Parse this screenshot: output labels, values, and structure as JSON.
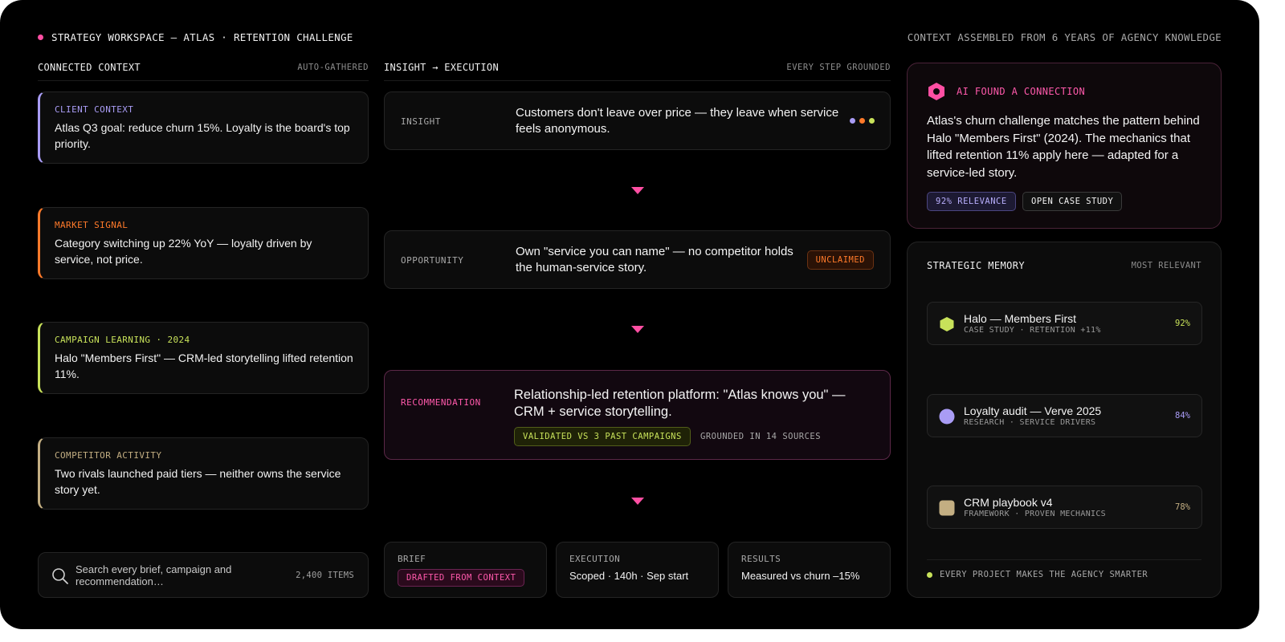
{
  "header": {
    "title": "STRATEGY WORKSPACE — ATLAS · RETENTION CHALLENGE",
    "context_note": "CONTEXT ASSEMBLED FROM 6 YEARS OF AGENCY KNOWLEDGE"
  },
  "context": {
    "title": "CONNECTED CONTEXT",
    "subtitle": "AUTO-GATHERED",
    "cards": [
      {
        "label": "CLIENT CONTEXT",
        "text": "Atlas Q3 goal: reduce churn 15%. Loyalty is the board's top priority.",
        "color": "#a99cf5"
      },
      {
        "label": "MARKET SIGNAL",
        "text": "Category switching up 22% YoY — loyalty driven by service, not price.",
        "color": "#ff7a2a"
      },
      {
        "label": "CAMPAIGN LEARNING · 2024",
        "text": "Halo \"Members First\" — CRM-led storytelling lifted retention 11%.",
        "color": "#c8e25a"
      },
      {
        "label": "COMPETITOR ACTIVITY",
        "text": "Two rivals launched paid tiers — neither owns the service story yet.",
        "color": "#c3ae82"
      }
    ],
    "search": {
      "placeholder": "Search every brief, campaign and recommendation…",
      "count": "2,400 ITEMS"
    }
  },
  "flow": {
    "title": "INSIGHT → EXECUTION",
    "subtitle": "EVERY STEP GROUNDED",
    "insight": {
      "label": "INSIGHT",
      "text": "Customers don't leave over price — they leave when service feels anonymous."
    },
    "opportunity": {
      "label": "OPPORTUNITY",
      "text": "Own \"service you can name\" — no competitor holds the human-service story.",
      "badge": "UNCLAIMED"
    },
    "recommendation": {
      "label": "RECOMMENDATION",
      "text": "Relationship-led retention platform: \"Atlas knows you\" — CRM + service storytelling.",
      "badge": "VALIDATED VS 3 PAST CAMPAIGNS",
      "grounding": "GROUNDED IN 14 SOURCES"
    },
    "brief": {
      "label": "BRIEF",
      "badge": "DRAFTED FROM CONTEXT"
    },
    "execution": {
      "label": "EXECUTION",
      "text": "Scoped · 140h · Sep start"
    },
    "results": {
      "label": "RESULTS",
      "text": "Measured vs churn –15%"
    }
  },
  "ai_connection": {
    "title": "AI FOUND A CONNECTION",
    "text": "Atlas's churn challenge matches the pattern behind Halo \"Members First\" (2024). The mechanics that lifted retention 11% apply here — adapted for a service-led story.",
    "relevance": "92% RELEVANCE",
    "open_button": "OPEN CASE STUDY",
    "icon": "hexagon-icon"
  },
  "memory": {
    "title": "STRATEGIC MEMORY",
    "subtitle": "MOST RELEVANT",
    "items": [
      {
        "name": "Halo — Members First",
        "meta": "CASE STUDY · RETENTION +11%",
        "score": "92%",
        "icon": "hexagon-icon",
        "color": "#c8e25a"
      },
      {
        "name": "Loyalty audit — Verve 2025",
        "meta": "RESEARCH · SERVICE DRIVERS",
        "score": "84%",
        "icon": "circle-icon",
        "color": "#a99cf5"
      },
      {
        "name": "CRM playbook v4",
        "meta": "FRAMEWORK · PROVEN MECHANICS",
        "score": "78%",
        "icon": "square-icon",
        "color": "#c3ae82"
      }
    ],
    "footer": "EVERY PROJECT MAKES THE AGENCY SMARTER"
  },
  "colors": {
    "accent": "#ff4fa3",
    "lime": "#c8e25a",
    "lavender": "#a99cf5",
    "orange": "#ff7a2a",
    "tan": "#c3ae82"
  }
}
